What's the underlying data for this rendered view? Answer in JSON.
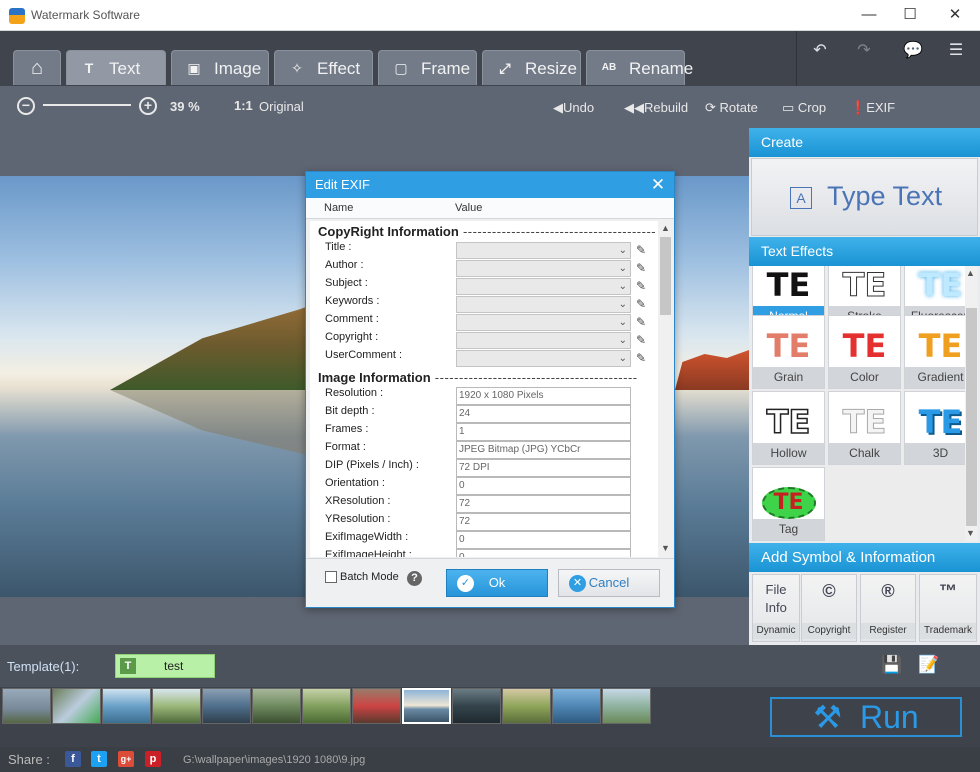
{
  "app": {
    "title": "Watermark Software"
  },
  "window_controls": [
    "—",
    "☐",
    "✕"
  ],
  "tabs": [
    {
      "label": "Text",
      "icon": "T",
      "active": true
    },
    {
      "label": "Image",
      "icon": "▣",
      "active": false
    },
    {
      "label": "Effect",
      "icon": "✧",
      "active": false
    },
    {
      "label": "Frame",
      "icon": "▢",
      "active": false
    },
    {
      "label": "Resize",
      "icon": "⤢",
      "active": false
    },
    {
      "label": "Rename",
      "icon": "AB",
      "active": false
    }
  ],
  "toolbar": {
    "zoom_level": "39 %",
    "original_icon": "1:1",
    "original": "Original",
    "undo": "Undo",
    "rebuild": "Rebuild",
    "rotate": "Rotate",
    "crop": "Crop",
    "exif": "EXIF"
  },
  "right_panel": {
    "create_header": "Create",
    "type_text": "Type Text",
    "text_effects_header": "Text Effects",
    "effects": [
      {
        "label": "Normal",
        "selected": true
      },
      {
        "label": "Stroke",
        "selected": false
      },
      {
        "label": "Fluorescen",
        "selected": false
      },
      {
        "label": "Grain",
        "selected": false
      },
      {
        "label": "Color",
        "selected": false
      },
      {
        "label": "Gradient",
        "selected": false
      },
      {
        "label": "Hollow",
        "selected": false
      },
      {
        "label": "Chalk",
        "selected": false
      },
      {
        "label": "3D",
        "selected": false
      },
      {
        "label": "Tag",
        "selected": false
      }
    ],
    "effect_glyph": "TE",
    "symbol_header": "Add Symbol & Information",
    "symbols": [
      {
        "glyph": "File Info",
        "label": "Dynamic"
      },
      {
        "glyph": "©",
        "label": "Copyright"
      },
      {
        "glyph": "®",
        "label": "Register"
      },
      {
        "glyph": "™",
        "label": "Trademark"
      }
    ]
  },
  "dialog": {
    "title": "Edit EXIF",
    "col_name": "Name",
    "col_value": "Value",
    "copyright_section": "CopyRight Information",
    "copyright_fields": [
      "Title :",
      "Author :",
      "Subject :",
      "Keywords :",
      "Comment :",
      "Copyright :",
      "UserComment :"
    ],
    "image_section": "Image Information",
    "image_fields": [
      {
        "label": "Resolution :",
        "value": "1920 x 1080 Pixels"
      },
      {
        "label": "Bit depth :",
        "value": "24"
      },
      {
        "label": "Frames :",
        "value": "1"
      },
      {
        "label": "Format :",
        "value": "JPEG Bitmap (JPG) YCbCr"
      },
      {
        "label": "DIP (Pixels / Inch) :",
        "value": "72 DPI"
      },
      {
        "label": "Orientation :",
        "value": "0"
      },
      {
        "label": "XResolution :",
        "value": "72"
      },
      {
        "label": "YResolution :",
        "value": "72"
      },
      {
        "label": "ExifImageWidth :",
        "value": "0"
      },
      {
        "label": "ExifImageHeight :",
        "value": "0"
      }
    ],
    "batch_mode": "Batch Mode",
    "ok": "Ok",
    "cancel": "Cancel"
  },
  "template": {
    "label": "Template(1):",
    "item": "test"
  },
  "run": "Run",
  "share": {
    "label": "Share :",
    "networks": [
      "f",
      "t",
      "g+",
      "p"
    ]
  },
  "status_path": "G:\\wallpaper\\images\\1920 1080\\9.jpg",
  "colors": {
    "accent": "#2f9ee3",
    "selected_effect": "#2f9ee3",
    "template_chip": "#b9f0a7",
    "run": "#2b9ae6"
  }
}
